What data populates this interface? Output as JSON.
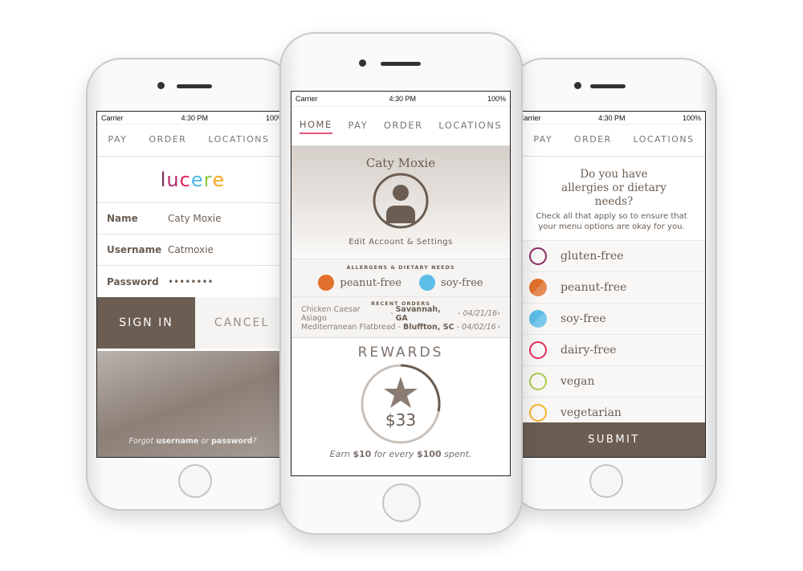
{
  "status": {
    "carrier": "Carrier",
    "time": "4:30 PM",
    "battery": "100%"
  },
  "left": {
    "nav": [
      "PAY",
      "ORDER",
      "LOCATIONS"
    ],
    "logo": "lucere",
    "logo_colors": [
      "#7a2c5e",
      "#b32a6c",
      "#e0245e",
      "#4db6e8",
      "#8dc63f",
      "#f6a823"
    ],
    "fields": [
      {
        "label": "Name",
        "value": "Caty Moxie"
      },
      {
        "label": "Username",
        "value": "Catmoxie"
      },
      {
        "label": "Password",
        "value": "••••••••"
      }
    ],
    "sign_in": "SIGN IN",
    "cancel": "CANCEL",
    "forgot": {
      "a": "Forgot ",
      "b": "username",
      "c": " or ",
      "d": "password",
      "e": "?"
    }
  },
  "center": {
    "nav": [
      "HOME",
      "PAY",
      "ORDER",
      "LOCATIONS"
    ],
    "name": "Caty Moxie",
    "edit": "Edit Account & Settings",
    "allergens_title": "ALLERGENS & DIETARY NEEDS",
    "allergens": [
      {
        "label": "peanut-free",
        "color": "#e0702c"
      },
      {
        "label": "soy-free",
        "color": "#5bbde8"
      }
    ],
    "recent_title": "RECENT ORDERS",
    "orders": [
      {
        "item": "Chicken Caesar Asiago",
        "loc": "Savannah, GA",
        "date": "04/21/16"
      },
      {
        "item": "Mediterranean Flatbread",
        "loc": "Bluffton, SC",
        "date": "04/02/16"
      }
    ],
    "rewards_title": "REWARDS",
    "rewards_amount": "$33",
    "rewards_progress": 0.28,
    "earn": {
      "a": "Earn ",
      "b": "$10",
      "c": " for every ",
      "d": "$100",
      "e": " spent."
    }
  },
  "right": {
    "nav": [
      "PAY",
      "ORDER",
      "LOCATIONS"
    ],
    "question": "Do you have allergies or dietary needs?",
    "sub": "Check all that apply so to ensure that your menu options are okay for you.",
    "options": [
      {
        "label": "gluten-free",
        "color": "#8a2b66",
        "filled": false
      },
      {
        "label": "peanut-free",
        "color": "#e0702c",
        "filled": true
      },
      {
        "label": "soy-free",
        "color": "#5bbde8",
        "filled": true
      },
      {
        "label": "dairy-free",
        "color": "#e52d5c",
        "filled": false
      },
      {
        "label": "vegan",
        "color": "#a9cc4a",
        "filled": false
      },
      {
        "label": "vegetarian",
        "color": "#f8b12a",
        "filled": false
      }
    ],
    "submit": "SUBMIT"
  }
}
